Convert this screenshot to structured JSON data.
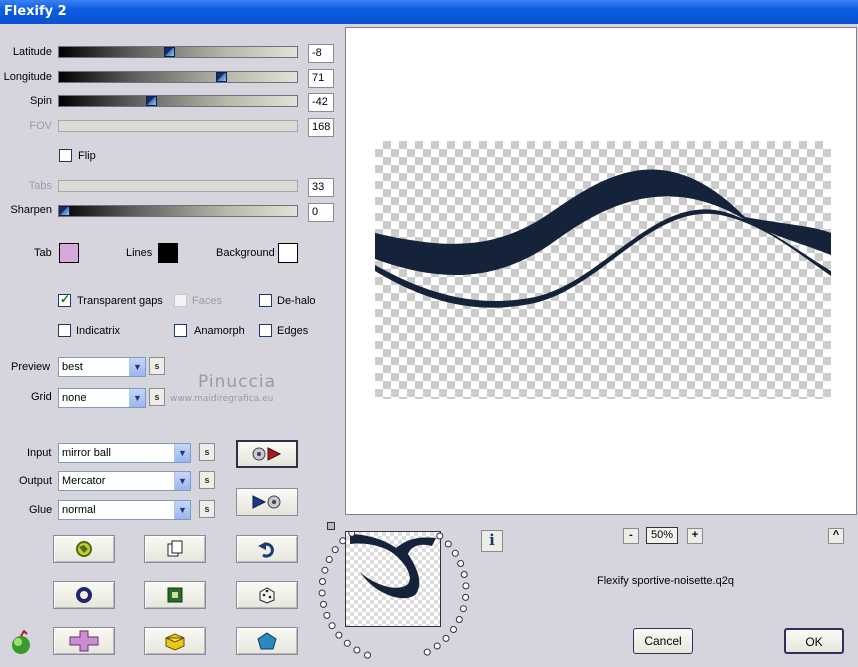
{
  "window": {
    "title": "Flexify 2"
  },
  "sliders": [
    {
      "label": "Latitude",
      "value": "-8",
      "pos": 0.46,
      "disabled": false
    },
    {
      "label": "Longitude",
      "value": "71",
      "pos": 0.69,
      "disabled": false
    },
    {
      "label": "Spin",
      "value": "-42",
      "pos": 0.38,
      "disabled": false
    },
    {
      "label": "FOV",
      "value": "168",
      "pos": null,
      "disabled": true
    }
  ],
  "flip": {
    "label": "Flip",
    "checked": false
  },
  "tabs_slider": {
    "label": "Tabs",
    "value": "33",
    "disabled": true
  },
  "sharpen_slider": {
    "label": "Sharpen",
    "value": "0",
    "pos": 0.0
  },
  "colors": {
    "tab": {
      "label": "Tab",
      "color": "#d8a8dc"
    },
    "lines": {
      "label": "Lines",
      "color": "#000000"
    },
    "background": {
      "label": "Background",
      "color": "#ffffff"
    }
  },
  "options": {
    "transparent_gaps": {
      "label": "Transparent gaps",
      "checked": true
    },
    "faces": {
      "label": "Faces",
      "checked": false,
      "disabled": true
    },
    "de_halo": {
      "label": "De-halo",
      "checked": false
    },
    "indicatrix": {
      "label": "Indicatrix",
      "checked": false
    },
    "anamorph": {
      "label": "Anamorph",
      "checked": false
    },
    "edges": {
      "label": "Edges",
      "checked": false
    }
  },
  "preview_select": {
    "label": "Preview",
    "value": "best"
  },
  "grid_select": {
    "label": "Grid",
    "value": "none"
  },
  "watermark": {
    "name": "Pinuccia",
    "url": "www.maidiregrafica.eu"
  },
  "input_select": {
    "label": "Input",
    "value": "mirror ball"
  },
  "output_select": {
    "label": "Output",
    "value": "Mercator"
  },
  "glue_select": {
    "label": "Glue",
    "value": "normal"
  },
  "small_button": "s",
  "zoom": {
    "minus": "-",
    "value": "50%",
    "plus": "+"
  },
  "filename": "Flexify sportive-noisette.q2q",
  "info_label": "i",
  "scroll_up": "^",
  "cancel_label": "Cancel",
  "ok_label": "OK",
  "accent": "#0b5de0",
  "wave_color": "#14233a"
}
